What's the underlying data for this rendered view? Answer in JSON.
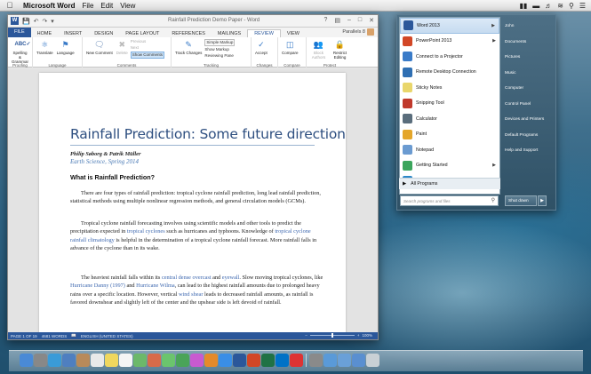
{
  "menubar": {
    "app_name": "Microsoft Word",
    "items": [
      "File",
      "Edit",
      "View"
    ],
    "status_icons": [
      "notification-icon",
      "battery-icon",
      "wifi-icon",
      "volume-icon",
      "search-icon",
      "list-icon"
    ]
  },
  "word": {
    "title": "Rainfall Prediction Demo Paper - Word",
    "tabs": [
      "FILE",
      "HOME",
      "INSERT",
      "DESIGN",
      "PAGE LAYOUT",
      "REFERENCES",
      "MAILINGS",
      "REVIEW",
      "VIEW"
    ],
    "active_tab": "REVIEW",
    "user_name": "Parallels 8",
    "ribbon": {
      "proofing": {
        "spelling": "Spelling & Grammar",
        "group": "Proofing"
      },
      "language": {
        "translate": "Translate",
        "language": "Language",
        "group": "Language"
      },
      "comments": {
        "new": "New Comment",
        "delete": "Delete",
        "previous": "Previous",
        "next": "Next",
        "show": "Show Comments",
        "group": "Comments"
      },
      "tracking": {
        "track": "Track Changes",
        "simple": "Simple Markup",
        "show_markup": "Show Markup",
        "reviewing": "Reviewing Pane",
        "group": "Tracking"
      },
      "changes": {
        "accept": "Accept",
        "group": "Changes"
      },
      "compare": {
        "compare": "Compare",
        "group": "Compare"
      },
      "protect": {
        "block": "Block Authors",
        "restrict": "Restrict Editing",
        "group": "Protect"
      }
    },
    "document": {
      "title": "Rainfall Prediction: Some future directions",
      "authors": "Philip Søborg & Patrik Müller",
      "subtitle": "Earth Science, Spring 2014",
      "heading": "What is Rainfall Prediction?",
      "p1": "There are four types of rainfall prediction: tropical cyclone rainfall prediction, long lead rainfall prediction, statistical methods using multiple nonlinear regression methods, and general circulation models (GCMs).",
      "p2_a": "Tropical cyclone rainfall forecasting involves using scientific models and other tools to predict the precipitation expected in ",
      "p2_link1": "tropical cyclones",
      "p2_b": " such as hurricanes and typhoons. Knowledge of ",
      "p2_link2": "tropical cyclone rainfall climatology",
      "p2_c": " is helpful in the determination of a tropical cyclone rainfall forecast. More rainfall falls in advance of the cyclone than in its wake.",
      "p3_a": "The heaviest rainfall falls within its ",
      "p3_link1": "central dense overcast",
      "p3_b": " and ",
      "p3_link2": "eyewall",
      "p3_c": ". Slow moving tropical cyclones, like ",
      "p3_link3": "Hurricane Danny (1997)",
      "p3_d": " and ",
      "p3_link4": "Hurricane Wilma",
      "p3_e": ", can lead to the highest rainfall amounts due to prolonged heavy rains over a specific location. However, vertical ",
      "p3_link5": "wind shear",
      "p3_f": " leads to decreased rainfall amounts, as rainfall is favored downshear and slightly left of the center and the upshear side is left devoid of rainfall."
    },
    "status": {
      "page": "PAGE 1 OF 19",
      "words": "4681 WORDS",
      "language": "ENGLISH (UNITED STATES)",
      "zoom": "100%"
    }
  },
  "startmenu": {
    "programs": [
      {
        "label": "Word 2013",
        "icon": "word-icon",
        "color": "#2b579a",
        "arrow": true
      },
      {
        "label": "PowerPoint 2013",
        "icon": "powerpoint-icon",
        "color": "#d24726",
        "arrow": true
      },
      {
        "label": "Connect to a Projector",
        "icon": "projector-icon",
        "color": "#3a7bc8",
        "arrow": false
      },
      {
        "label": "Remote Desktop Connection",
        "icon": "remote-desktop-icon",
        "color": "#2f6fb3",
        "arrow": false
      },
      {
        "label": "Sticky Notes",
        "icon": "sticky-notes-icon",
        "color": "#e9d66b",
        "arrow": false
      },
      {
        "label": "Snipping Tool",
        "icon": "scissors-icon",
        "color": "#c0392b",
        "arrow": false
      },
      {
        "label": "Calculator",
        "icon": "calculator-icon",
        "color": "#5a6d7c",
        "arrow": false
      },
      {
        "label": "Paint",
        "icon": "paint-icon",
        "color": "#e4a62a",
        "arrow": false
      },
      {
        "label": "Notepad",
        "icon": "notepad-icon",
        "color": "#6b9bd1",
        "arrow": false
      },
      {
        "label": "Getting Started",
        "icon": "getting-started-icon",
        "color": "#3ba55c",
        "arrow": true
      },
      {
        "label": "XPS Viewer",
        "icon": "xps-viewer-icon",
        "color": "#2d88c8",
        "arrow": false
      }
    ],
    "all_programs": "All Programs",
    "search_placeholder": "Search programs and files",
    "right_items": [
      "John",
      "Documents",
      "Pictures",
      "Music",
      "Computer",
      "Control Panel",
      "Devices and Printers",
      "Default Programs",
      "Help and Support"
    ],
    "shutdown": "Shut down"
  },
  "dock": {
    "icons": [
      {
        "name": "finder-icon",
        "color": "#4a8ad6"
      },
      {
        "name": "launchpad-icon",
        "color": "#888"
      },
      {
        "name": "safari-icon",
        "color": "#3a9bd8"
      },
      {
        "name": "mail-icon",
        "color": "#4f7fc0"
      },
      {
        "name": "contacts-icon",
        "color": "#b88a5a"
      },
      {
        "name": "calendar-icon",
        "color": "#e9e9e9"
      },
      {
        "name": "notes-icon",
        "color": "#f0d75e"
      },
      {
        "name": "reminders-icon",
        "color": "#f5f5f5"
      },
      {
        "name": "maps-icon",
        "color": "#6cb86a"
      },
      {
        "name": "photos-icon",
        "color": "#d86b4a"
      },
      {
        "name": "messages-icon",
        "color": "#6bc46d"
      },
      {
        "name": "facetime-icon",
        "color": "#4aa458"
      },
      {
        "name": "itunes-icon",
        "color": "#c85ad0"
      },
      {
        "name": "ibooks-icon",
        "color": "#e58a2a"
      },
      {
        "name": "appstore-icon",
        "color": "#3a8ee6"
      },
      {
        "name": "word-dock-icon",
        "color": "#2b579a"
      },
      {
        "name": "powerpoint-dock-icon",
        "color": "#d24726"
      },
      {
        "name": "excel-dock-icon",
        "color": "#207245"
      },
      {
        "name": "outlook-dock-icon",
        "color": "#0072c6"
      },
      {
        "name": "parallels-icon",
        "color": "#d33"
      },
      {
        "name": "system-preferences-icon",
        "color": "#8a8a8a"
      },
      {
        "name": "itunes-store-icon",
        "color": "#5a9ad8"
      },
      {
        "name": "app-folder-icon",
        "color": "#6aa0d8"
      },
      {
        "name": "downloads-icon",
        "color": "#5a8fd0"
      },
      {
        "name": "trash-icon",
        "color": "#c9d0d5"
      }
    ]
  }
}
